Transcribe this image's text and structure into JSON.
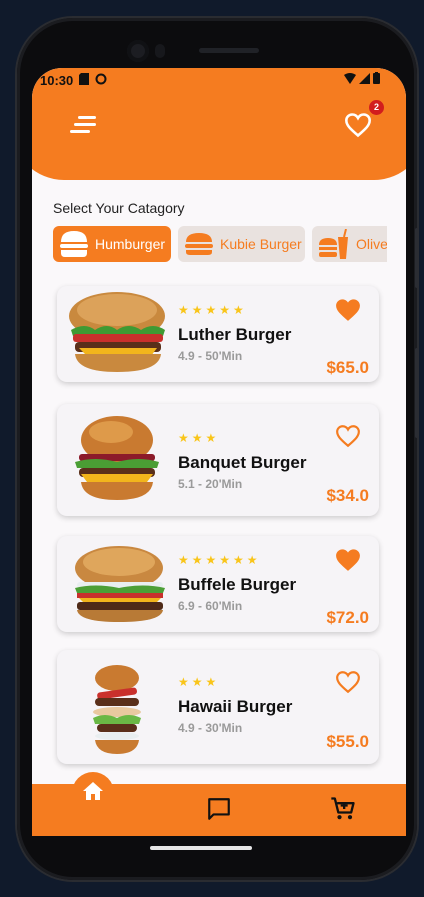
{
  "status_bar": {
    "time": "10:30"
  },
  "header": {
    "favorites_count": "2"
  },
  "category_section": {
    "title": "Select Your Catagory",
    "categories": [
      {
        "label": "Humburger",
        "active": true,
        "icon": "burger-icon"
      },
      {
        "label": "Kubie Burger",
        "active": false,
        "icon": "burger-icon"
      },
      {
        "label": "Olive",
        "active": false,
        "icon": "burger-drink-icon"
      }
    ]
  },
  "products": [
    {
      "name": "Luther Burger",
      "rating_stars": "★★★★★",
      "meta": "4.9 - 50'Min",
      "price": "$65.0",
      "favorite": true
    },
    {
      "name": "Banquet Burger",
      "rating_stars": "★★★",
      "meta": "5.1 - 20'Min",
      "price": "$34.0",
      "favorite": false
    },
    {
      "name": "Buffele Burger",
      "rating_stars": "★★★★★★",
      "meta": "6.9 - 60'Min",
      "price": "$72.0",
      "favorite": true
    },
    {
      "name": "Hawaii Burger",
      "rating_stars": "★★★",
      "meta": "4.9 - 30'Min",
      "price": "$55.0",
      "favorite": false
    }
  ],
  "bottom_nav": {
    "items": [
      "home-icon",
      "chat-icon",
      "cart-icon"
    ]
  },
  "colors": {
    "accent": "#f57c20",
    "star": "#f9c51a",
    "badge": "#d21d1d",
    "background": "#faf8fa"
  }
}
